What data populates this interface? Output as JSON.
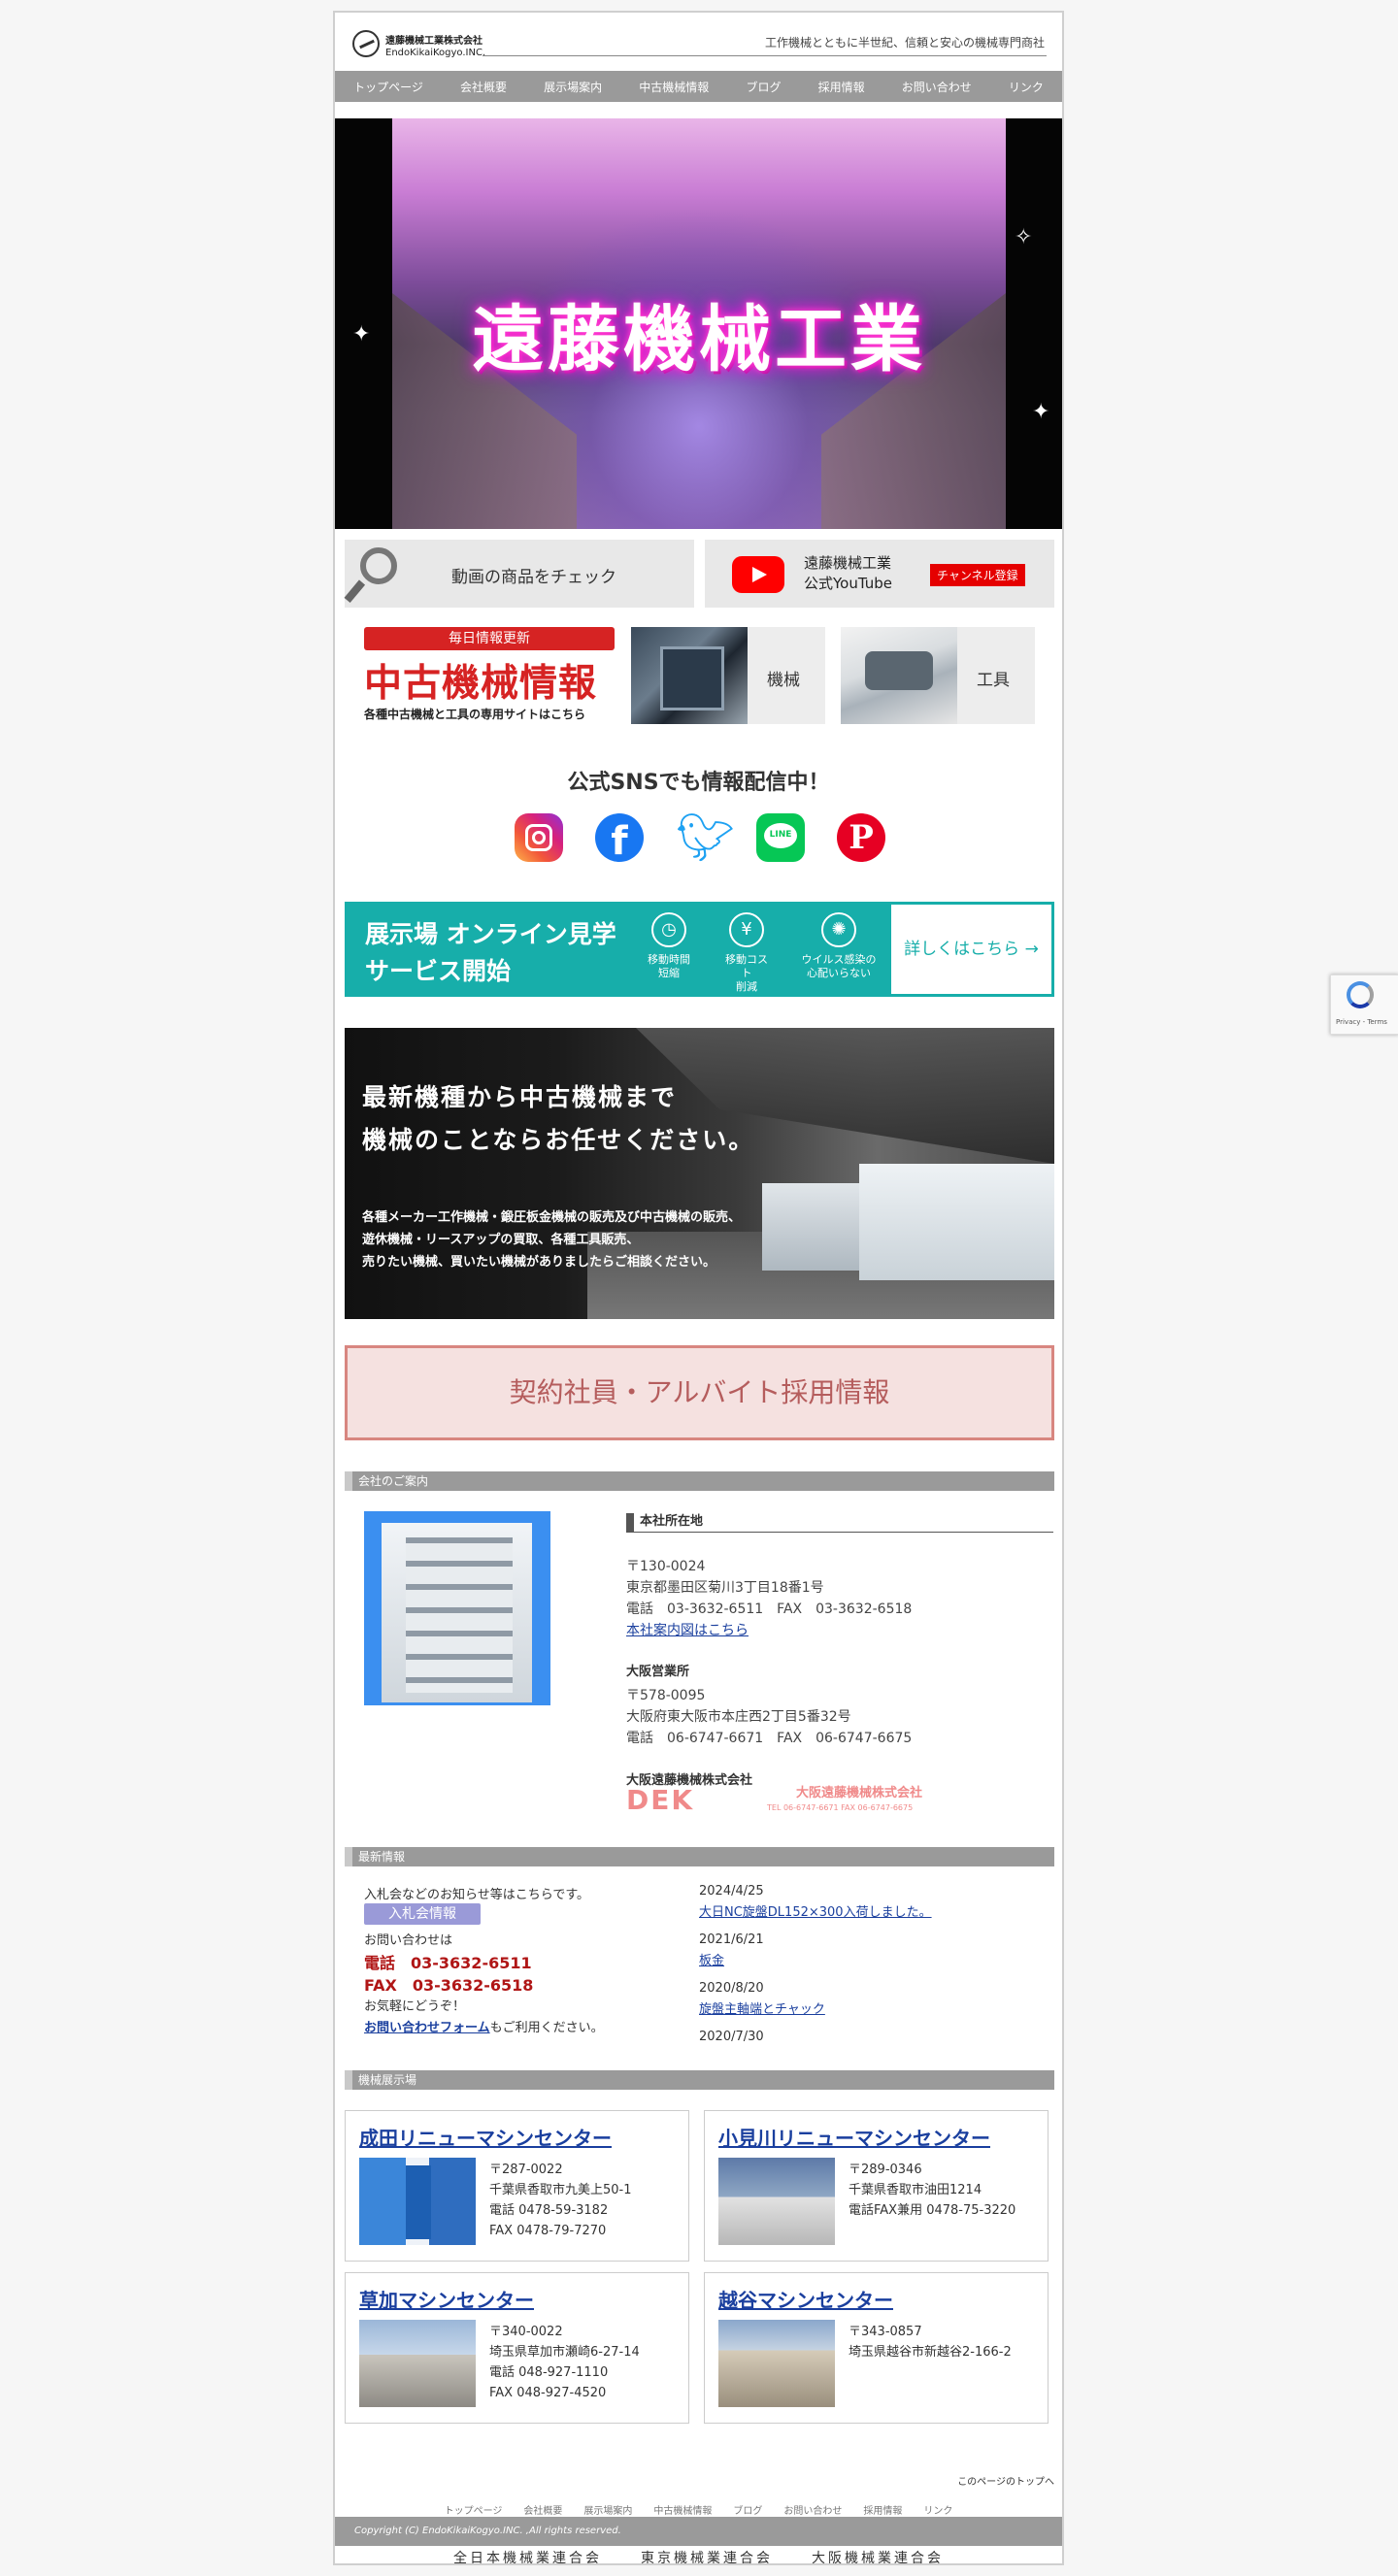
{
  "header": {
    "logo_jp": "遠藤機械工業株式会社",
    "logo_en": "EndoKikaiKogyo.INC.",
    "tagline": "工作機械とともに半世紀、信頼と安心の機械専門商社"
  },
  "nav": [
    "トップページ",
    "会社概要",
    "展示場案内",
    "中古機械情報",
    "ブログ",
    "採用情報",
    "お問い合わせ",
    "リンク"
  ],
  "hero": {
    "title": "遠藤機械工業"
  },
  "video": {
    "check_label": "動画の商品をチェック",
    "yt_line1": "遠藤機械工業",
    "yt_line2": "公式YouTube",
    "subscribe": "チャンネル登録"
  },
  "used": {
    "tag": "毎日情報更新",
    "title": "中古機械情報",
    "sub": "各種中古機械と工具の専用サイトはこちら",
    "machine_label": "機械",
    "tool_label": "工具"
  },
  "sns": {
    "title": "公式SNSでも情報配信中！",
    "line_text": "LINE"
  },
  "online": {
    "title_line1": "展示場 オンライン見学",
    "title_line2": "サービス開始",
    "icons": [
      {
        "line1": "移動時間",
        "line2": "短縮"
      },
      {
        "line1": "移動コスト",
        "line2": "削減"
      },
      {
        "line1": "ウイルス感染の",
        "line2": "心配いらない"
      }
    ],
    "link": "詳しくはこちら →"
  },
  "banner": {
    "h1": "最新機種から中古機械まで",
    "h2": "機械のことならお任せください。",
    "p1": "各種メーカー工作機械・鍛圧板金機械の販売及び中古機械の販売、",
    "p2": "遊休機械・リースアップの買取、各種工具販売、",
    "p3": "売りたい機械、買いたい機械がありましたらご相談ください。"
  },
  "recruit": {
    "label": "契約社員・アルバイト採用情報"
  },
  "company": {
    "section": "会社のご案内",
    "hq_title": "本社所在地",
    "hq_zip": "〒130-0024",
    "hq_addr": "東京都墨田区菊川3丁目18番1号",
    "hq_tel": "電話　03-3632-6511　FAX　03-3632-6518",
    "hq_map": "本社案内図はこちら",
    "osaka_title": "大阪営業所",
    "osaka_zip": "〒578-0095",
    "osaka_addr": "大阪府東大阪市本庄西2丁目5番32号",
    "osaka_tel": "電話　06-6747-6671　FAX　06-6747-6675",
    "osaka2_title": "大阪遠藤機械株式会社",
    "dek_logo": "DEK",
    "dek_name": "大阪遠藤機械株式会社",
    "dek_small": "TEL 06-6747-6671  FAX 06-6747-6675"
  },
  "news": {
    "section": "最新情報",
    "intro": "入札会などのお知らせ等はこちらです。",
    "button": "入札会情報",
    "contact": "お問い合わせは",
    "tel": "電話　03-3632-6511",
    "fax": "FAX　03-3632-6518",
    "welcome": "お気軽にどうぞ！",
    "form_link": "お問い合わせフォーム",
    "form_suffix": "もご利用ください。",
    "items": [
      {
        "date": "2024/4/25",
        "title": "大日NC旋盤DL152×300入荷しました。"
      },
      {
        "date": "2021/6/21",
        "title": "板金"
      },
      {
        "date": "2020/8/20",
        "title": "旋盤主軸端とチャック"
      },
      {
        "date": "2020/7/30",
        "title": ""
      }
    ]
  },
  "centers": {
    "section": "機械展示場",
    "list": [
      {
        "name": "成田リニューマシンセンター",
        "l1": "〒287-0022",
        "l2": "千葉県香取市九美上50-1",
        "l3": "電話 0478-59-3182",
        "l4": "FAX 0478-79-7270"
      },
      {
        "name": "小見川リニューマシンセンター",
        "l1": "〒289-0346",
        "l2": "千葉県香取市油田1214",
        "l3": "電話FAX兼用 0478-75-3220",
        "l4": ""
      },
      {
        "name": "草加マシンセンター",
        "l1": "〒340-0022",
        "l2": "埼玉県草加市瀬崎6-27-14",
        "l3": "電話 048-927-1110",
        "l4": "FAX 048-927-4520"
      },
      {
        "name": "越谷マシンセンター",
        "l1": "〒343-0857",
        "l2": "埼玉県越谷市新越谷2-166-2",
        "l3": "",
        "l4": ""
      }
    ]
  },
  "footer": {
    "page_top": "このページのトップへ",
    "nav": [
      "トップページ",
      "会社概要",
      "展示場案内",
      "中古機械情報",
      "ブログ",
      "お問い合わせ",
      "採用情報",
      "リンク"
    ],
    "copyright": "Copyright (C) EndoKikaiKogyo.INC. ,All rights reserved.",
    "assoc": [
      "全日本機械業連合会",
      "東京機械業連合会",
      "大阪機械業連合会"
    ]
  },
  "recaptcha": {
    "text": "Privacy - Terms"
  }
}
